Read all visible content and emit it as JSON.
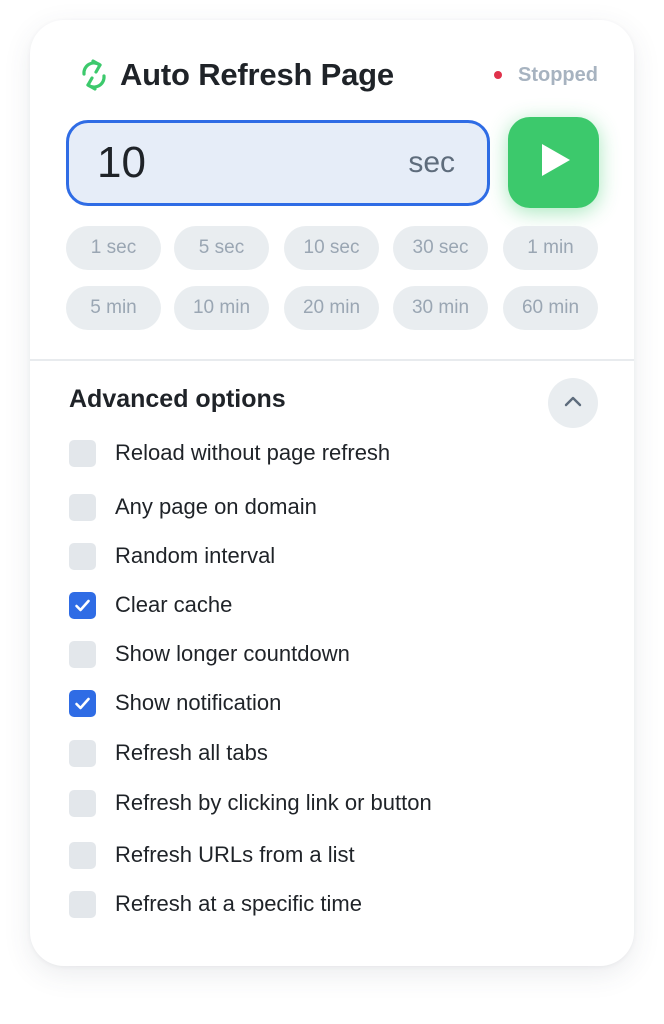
{
  "app": {
    "title": "Auto Refresh Page",
    "status": "Stopped",
    "status_color": "#e0324b",
    "logo_icon": "refresh-cycle-icon",
    "accent_color": "#2f6ce5",
    "start_color": "#3cc96c"
  },
  "interval": {
    "value": "10",
    "unit": "sec"
  },
  "presets": [
    "1 sec",
    "5 sec",
    "10 sec",
    "30 sec",
    "1 min",
    "5 min",
    "10 min",
    "20 min",
    "30 min",
    "60 min"
  ],
  "advanced": {
    "title": "Advanced options",
    "toggle_icon": "chevron-up-icon",
    "options": [
      {
        "label": "Reload without page refresh",
        "checked": false
      },
      {
        "label": "Any page on domain",
        "checked": false
      },
      {
        "label": "Random interval",
        "checked": false
      },
      {
        "label": "Clear cache",
        "checked": true
      },
      {
        "label": "Show longer countdown",
        "checked": false
      },
      {
        "label": "Show notification",
        "checked": true
      },
      {
        "label": "Refresh all tabs",
        "checked": false
      },
      {
        "label": "Refresh by clicking link or button",
        "checked": false
      },
      {
        "label": "Refresh URLs from a list",
        "checked": false
      },
      {
        "label": "Refresh at a specific time",
        "checked": false
      }
    ]
  }
}
